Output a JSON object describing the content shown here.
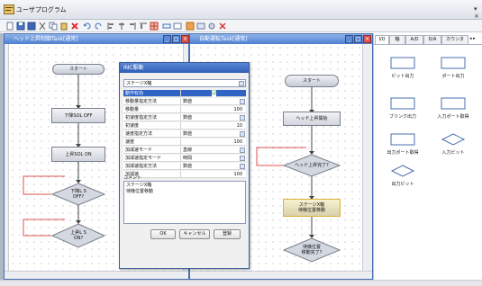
{
  "app": {
    "title": "ユーザプログラム",
    "menu_button": "▾ ×"
  },
  "toolbar": {
    "icons": [
      "new-icon",
      "save-icon",
      "save-all-icon",
      "cut-icon",
      "copy-icon",
      "paste-icon",
      "delete-icon",
      "undo-icon",
      "redo-icon",
      "align-left-icon",
      "align-center-icon",
      "align-right-icon",
      "align-top-icon",
      "grid-icon",
      "link-icon",
      "unlink-icon",
      "zoom-icon",
      "window-icon",
      "settings-icon",
      "close-x-icon"
    ]
  },
  "windows": {
    "left": {
      "title": "ヘッド上昇制御Task[通常]",
      "nodes": {
        "start": "スタート",
        "lower_sol_off": "下降SOL OFF",
        "upper_sol_on": "上昇SOL ON",
        "lower_check": "下降L S\nOFF?",
        "upper_check": "上昇L S\nON?"
      }
    },
    "right": {
      "title": "自動運転Task[通常]",
      "nodes": {
        "start": "スタート",
        "head_up_start": "ヘッド上昇開始",
        "head_up_done": "ヘッド上昇完了?",
        "stage_move": "ステージX軸\n待機位置移動",
        "wait_done": "待機位置\n移動完了?"
      }
    }
  },
  "dialog": {
    "title": "INC駆動",
    "axis_select": "ステージX軸",
    "rows": [
      {
        "key": "動作有効",
        "value": "☑",
        "type": "check"
      },
      {
        "key": "移動量指定方法",
        "value": "数値",
        "type": "dropdown"
      },
      {
        "key": "移動量",
        "value": "100",
        "type": "number"
      },
      {
        "key": "初速度指定方法",
        "value": "数値",
        "type": "dropdown"
      },
      {
        "key": "初速度",
        "value": "10",
        "type": "number"
      },
      {
        "key": "速度指定方法",
        "value": "数値",
        "type": "dropdown"
      },
      {
        "key": "速度",
        "value": "100",
        "type": "number"
      },
      {
        "key": "加減速モード",
        "value": "直線",
        "type": "dropdown"
      },
      {
        "key": "加減速指定モード",
        "value": "時間",
        "type": "dropdown"
      },
      {
        "key": "加減速指定方法",
        "value": "数値",
        "type": "dropdown"
      },
      {
        "key": "加減速",
        "value": "100",
        "type": "number"
      }
    ],
    "comment_label": "コメント",
    "comment_text": "ステージX軸\n待機位置移動",
    "ok": "OK",
    "cancel": "キャンセル",
    "register": "登録"
  },
  "right_panel": {
    "tabs": [
      "I/O",
      "軸",
      "A/D",
      "D/A",
      "カウンタ"
    ],
    "tab_arrows": "◂ ▸",
    "items": [
      {
        "label": "ビット出力",
        "shape": "rect"
      },
      {
        "label": "ポート出力",
        "shape": "rect"
      },
      {
        "label": "ブリンク出力",
        "shape": "rect"
      },
      {
        "label": "入力ポート取得",
        "shape": "rect"
      },
      {
        "label": "出力ポート取得",
        "shape": "rect"
      },
      {
        "label": "入力ビット",
        "shape": "diamond"
      },
      {
        "label": "出力ビット",
        "shape": "diamond"
      }
    ]
  },
  "colors": {
    "title_bar": "#4e80d0",
    "selected_node": "#d8b23a",
    "loop_line": "#e05050"
  }
}
